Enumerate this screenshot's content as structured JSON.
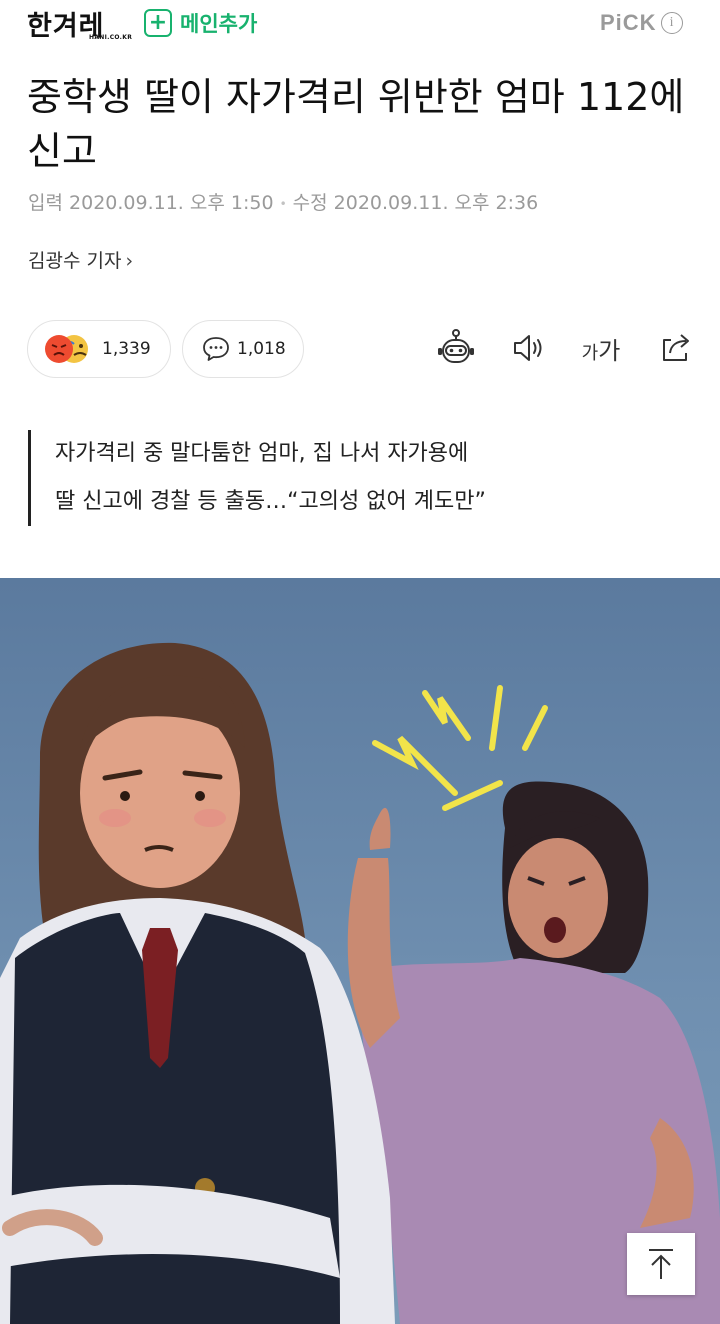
{
  "header": {
    "logo_text": "한겨레",
    "logo_sub": "HANI.CO.KR",
    "add_main_label": "메인추가",
    "add_main_icon": "plus-icon",
    "pick_label": "PiCK",
    "pick_info_icon": "i",
    "accent_color": "#18b26e"
  },
  "article": {
    "title": "중학생 딸이 자가격리 위반한 엄마 112에 신고",
    "meta": {
      "input_label": "입력",
      "input_time": "2020.09.11. 오후 1:50",
      "modified_label": "수정",
      "modified_time": "2020.09.11. 오후 2:36"
    },
    "reporter": "김광수 기자",
    "subtitle_lines": [
      "자가격리 중 말다툼한 엄마, 집 나서 자가용에",
      "딸 신고에 경찰 등 출동…“고의성 없어 계도만”"
    ]
  },
  "actions": {
    "reaction_count": "1,339",
    "reaction_icons": [
      "angry-face-icon",
      "sad-face-icon"
    ],
    "comment_count": "1,018",
    "comment_icon": "speech-bubble-icon",
    "tools": [
      "robot-summary-icon",
      "speaker-icon",
      "font-size-icon",
      "share-icon"
    ],
    "font_small": "가",
    "font_big": "가"
  },
  "scroll_top_icon": "arrow-up-icon"
}
